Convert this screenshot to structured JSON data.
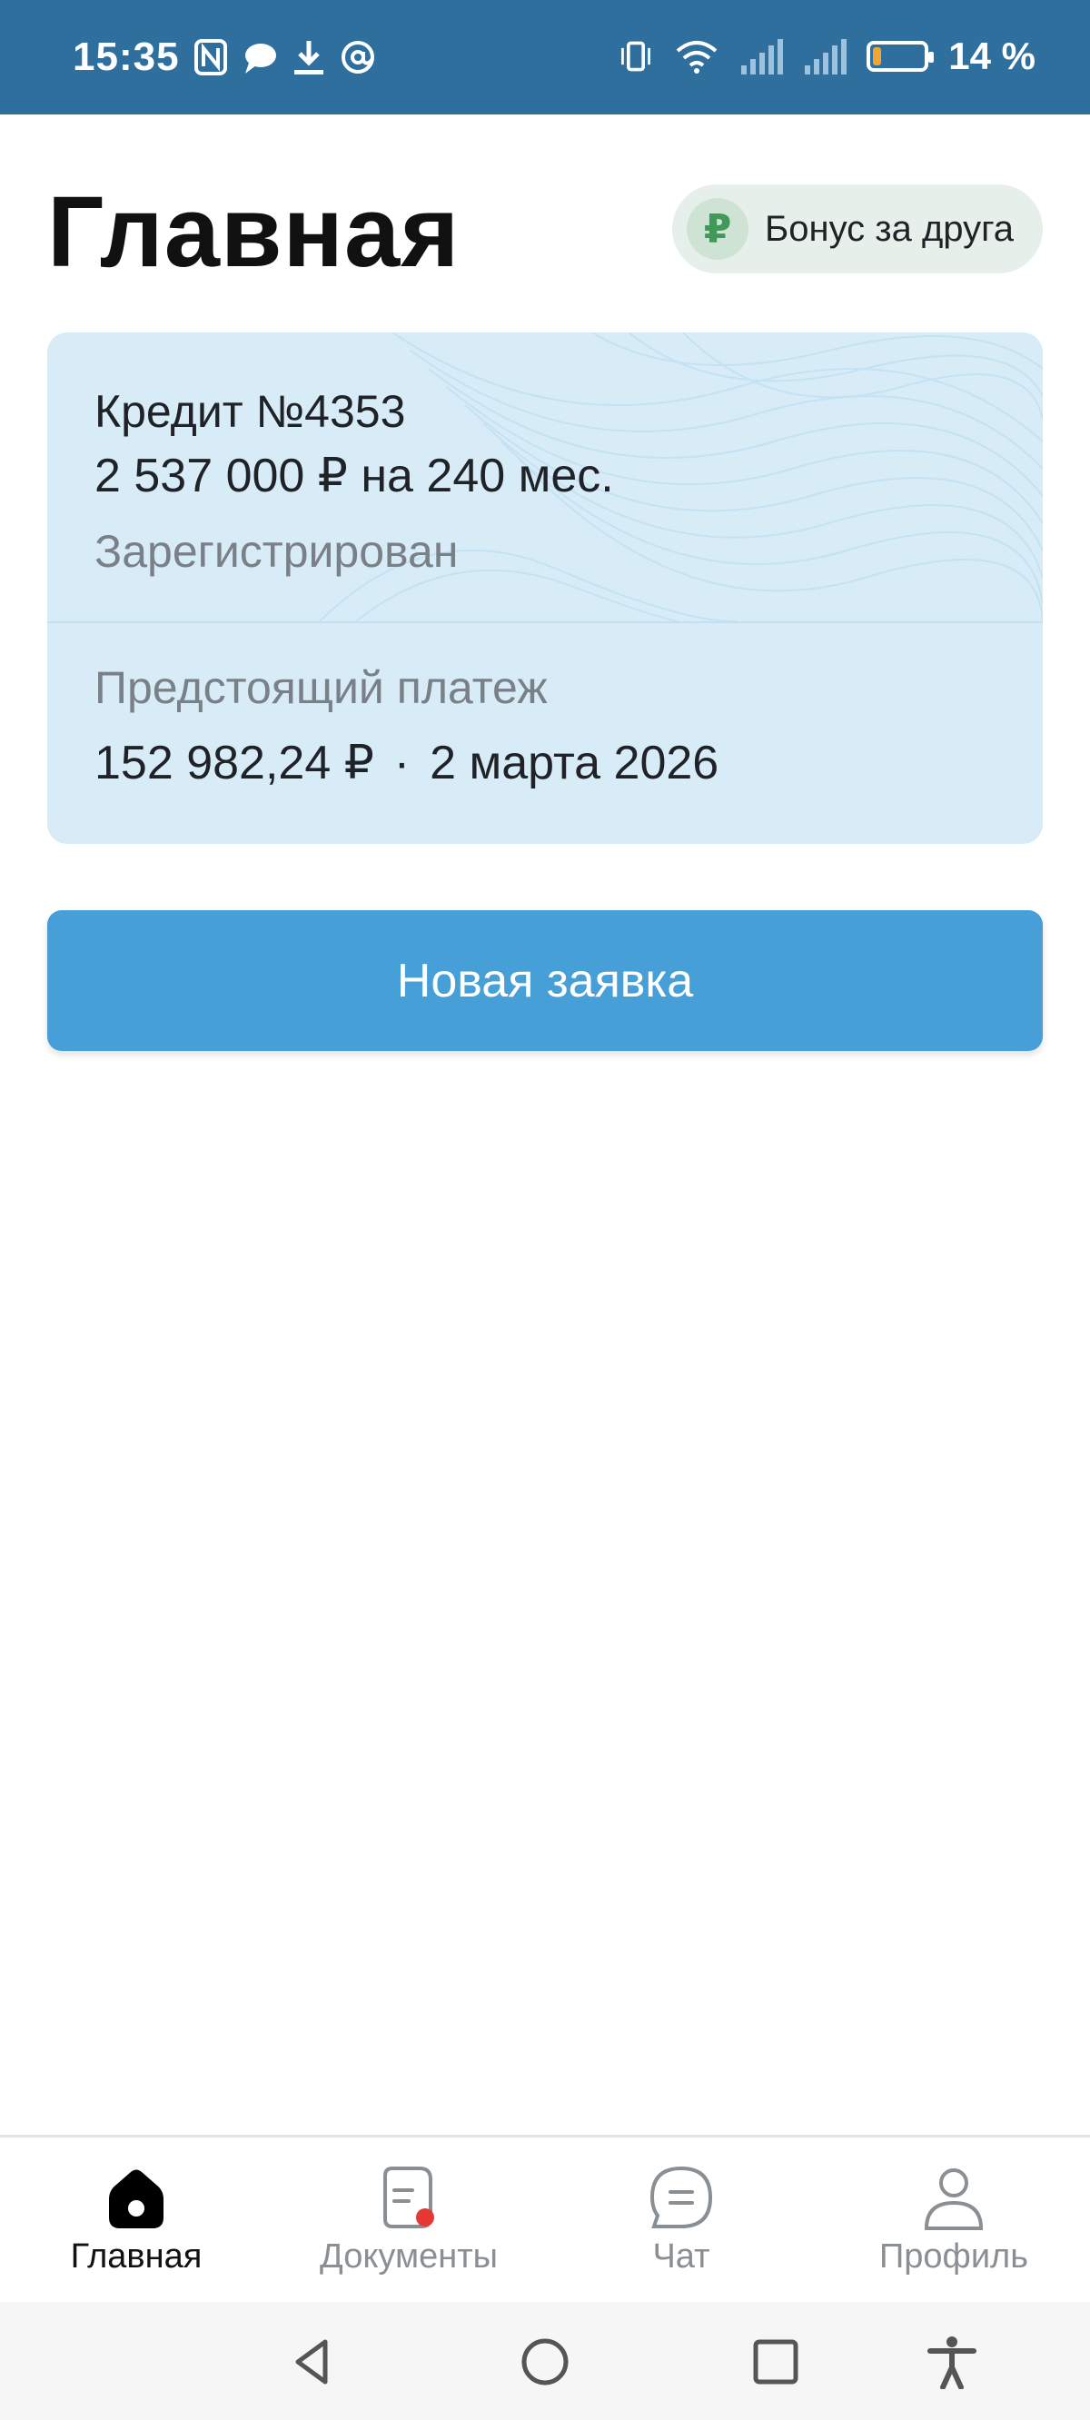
{
  "status_bar": {
    "time": "15:35",
    "left_icons": [
      "nfc-icon",
      "chat-bubble-icon",
      "download-icon",
      "at-icon"
    ],
    "right_icons": [
      "vibrate-icon",
      "wifi-icon",
      "signal-icon",
      "signal-icon"
    ],
    "battery_percent": "14 %",
    "battery_level": 0.14
  },
  "header": {
    "title": "Главная",
    "bonus_button": {
      "icon": "ruble-coin-icon",
      "label": "Бонус за друга"
    }
  },
  "credit_card": {
    "title": "Кредит №4353",
    "amount": "2 537 000 ₽ на 240 мес.",
    "status": "Зарегистрирован",
    "upcoming_label": "Предстоящий платеж",
    "upcoming_amount": "152 982,24 ₽",
    "separator": "·",
    "upcoming_date": "2 марта 2026"
  },
  "actions": {
    "new_application": "Новая заявка"
  },
  "bottom_nav": {
    "items": [
      {
        "label": "Главная",
        "icon": "home-icon",
        "active": true
      },
      {
        "label": "Документы",
        "icon": "document-icon",
        "badge": true
      },
      {
        "label": "Чат",
        "icon": "chat-icon"
      },
      {
        "label": "Профиль",
        "icon": "profile-icon"
      }
    ]
  },
  "system_nav": [
    "back-icon",
    "home-circle-icon",
    "recents-icon",
    "accessibility-icon"
  ],
  "colors": {
    "status_bar": "#2f6f9e",
    "card_bg": "#d8ecf7",
    "primary_button": "#479fd8",
    "badge_red": "#e53935",
    "bonus_green": "#3f9a5a"
  }
}
